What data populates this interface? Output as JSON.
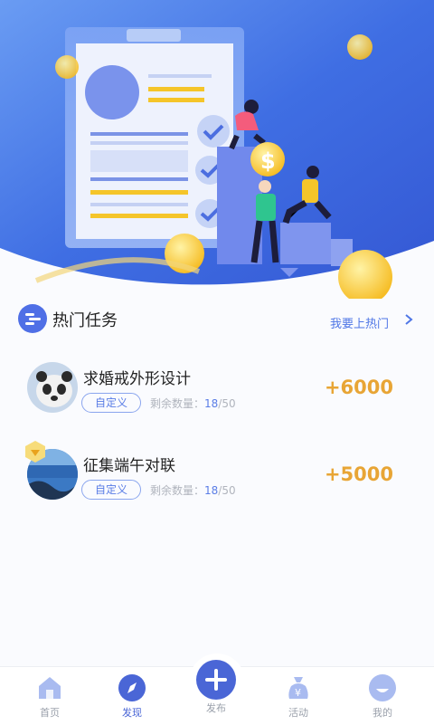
{
  "section": {
    "title": "热门任务",
    "link": "我要上热门"
  },
  "tasks": [
    {
      "title": "求婚戒外形设计",
      "tag": "自定义",
      "remain_label": "剩余数量：",
      "remain_current": "18",
      "remain_total": "/50",
      "reward": "+6000"
    },
    {
      "title": "征集端午对联",
      "tag": "自定义",
      "remain_label": "剩余数量：",
      "remain_current": "18",
      "remain_total": "/50",
      "reward": "+5000"
    }
  ],
  "tabbar": {
    "items": [
      {
        "label": "首页",
        "icon": "home-icon"
      },
      {
        "label": "发现",
        "icon": "compass-icon",
        "active": true
      },
      {
        "label": "发布",
        "icon": "plus-icon"
      },
      {
        "label": "活动",
        "icon": "money-bag-icon"
      },
      {
        "label": "我的",
        "icon": "smile-icon"
      }
    ]
  },
  "colors": {
    "accent": "#4a66d6",
    "reward": "#e8a535",
    "hero_blue": "#3f6ee3"
  }
}
